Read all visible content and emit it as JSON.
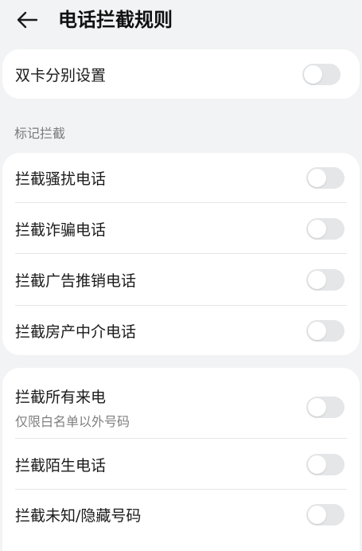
{
  "header": {
    "title": "电话拦截规则",
    "back_icon": "arrow-left-icon"
  },
  "dual_sim": {
    "label": "双卡分别设置",
    "enabled": false
  },
  "marked_section": {
    "title": "标记拦截",
    "items": [
      {
        "label": "拦截骚扰电话",
        "enabled": false
      },
      {
        "label": "拦截诈骗电话",
        "enabled": false
      },
      {
        "label": "拦截广告推销电话",
        "enabled": false
      },
      {
        "label": "拦截房产中介电话",
        "enabled": false
      }
    ]
  },
  "other_section": {
    "items": [
      {
        "label": "拦截所有来电",
        "sublabel": "仅限白名单以外号码",
        "enabled": false
      },
      {
        "label": "拦截陌生电话",
        "enabled": false
      },
      {
        "label": "拦截未知/隐藏号码",
        "enabled": false
      }
    ]
  },
  "colors": {
    "background": "#f1f3f5",
    "card": "#ffffff",
    "toggle_off": "#e4e6e8",
    "secondary_text": "#808080"
  }
}
